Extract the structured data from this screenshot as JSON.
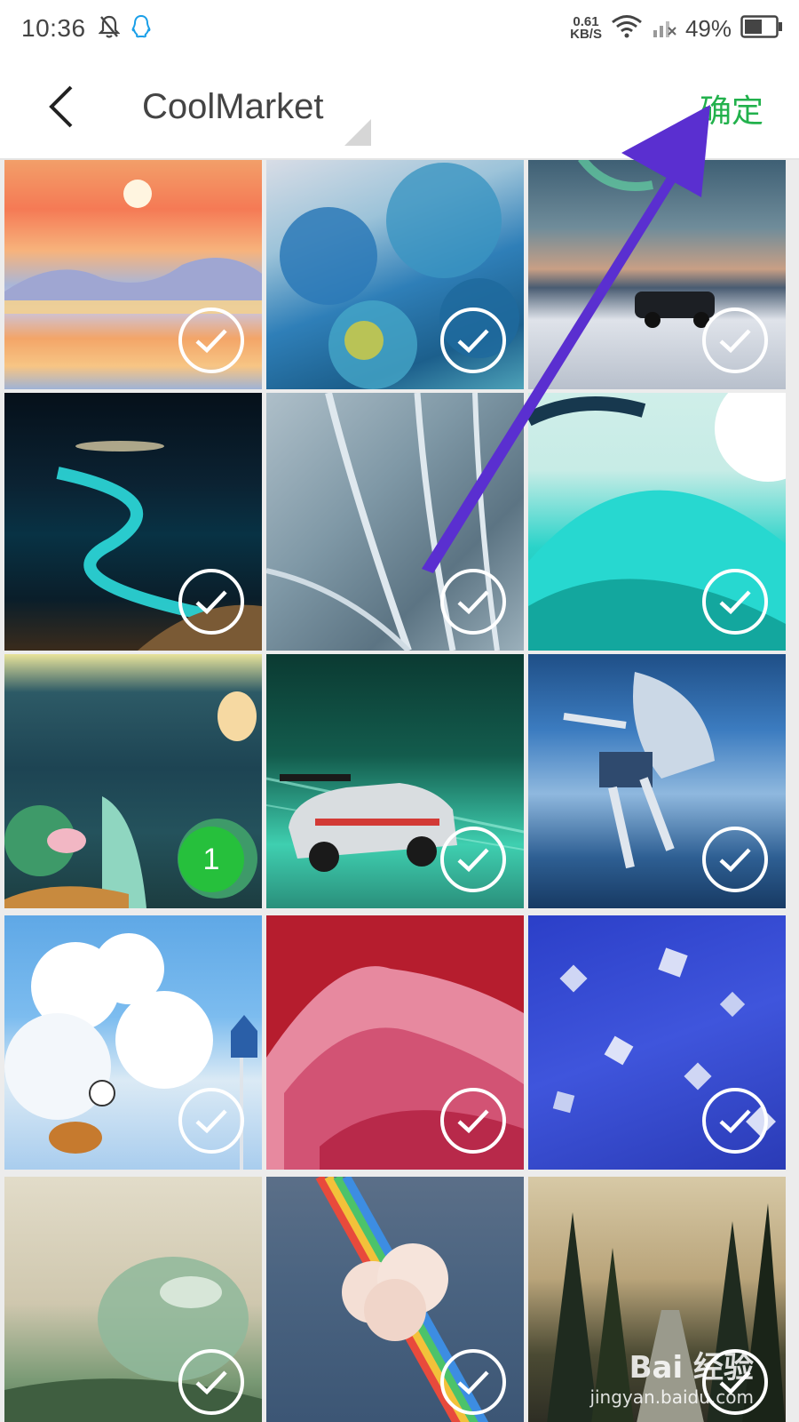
{
  "status_bar": {
    "time": "10:36",
    "net_speed_value": "0.61",
    "net_speed_unit": "KB/S",
    "battery": "49%",
    "icons": [
      "bell-off-icon",
      "qq-icon",
      "wifi-icon",
      "signal-off-icon",
      "battery-icon"
    ]
  },
  "header": {
    "back_icon": "chevron-left-icon",
    "album_title": "CoolMarket",
    "confirm_label": "确定",
    "accent_color": "#22b14c"
  },
  "photos": [
    {
      "name": "sunset-painting",
      "selected_index": null
    },
    {
      "name": "blue-flowers",
      "selected_index": null
    },
    {
      "name": "rally-car-snow",
      "selected_index": null
    },
    {
      "name": "glowing-beach",
      "selected_index": null
    },
    {
      "name": "abstract-blue-curves",
      "selected_index": null
    },
    {
      "name": "teal-hills",
      "selected_index": null
    },
    {
      "name": "lotus-illustration",
      "selected_index": "1"
    },
    {
      "name": "race-car",
      "selected_index": null
    },
    {
      "name": "sky-jumper",
      "selected_index": null
    },
    {
      "name": "clouds-cyclist",
      "selected_index": null
    },
    {
      "name": "red-coral",
      "selected_index": null
    },
    {
      "name": "blue-crystals",
      "selected_index": null
    },
    {
      "name": "water-droplet",
      "selected_index": null
    },
    {
      "name": "rainbow-cloud-sea",
      "selected_index": null
    },
    {
      "name": "forest-road",
      "selected_index": null
    }
  ],
  "watermark": {
    "main": "Bai 经验",
    "sub": "jingyan.baidu.com"
  }
}
